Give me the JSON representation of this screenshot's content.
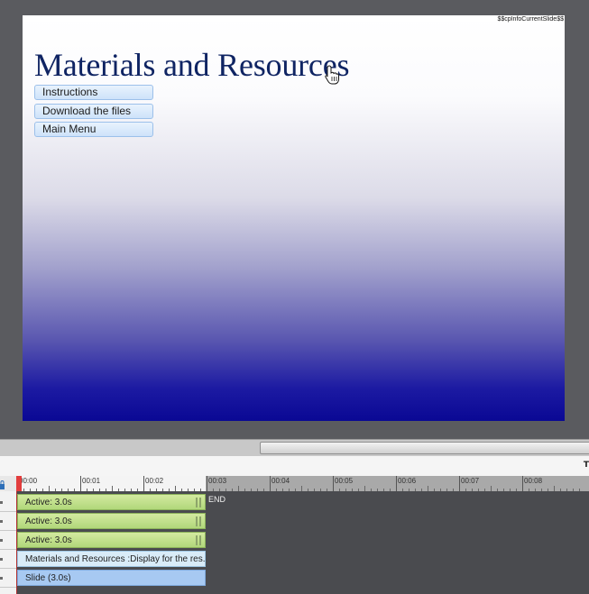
{
  "slide": {
    "info_text": "$$cpInfoCurrentSlide$$",
    "title": "Materials and Resources",
    "buttons": [
      "Instructions",
      "Download the files",
      "Main Menu"
    ],
    "background_colors": [
      "#ffffff",
      "#0a0894"
    ]
  },
  "timeline": {
    "header_text": "T",
    "ruler_labels": [
      "00:00",
      "00:01",
      "00:02",
      "00:03",
      "00:04",
      "00:05",
      "00:06",
      "00:07",
      "00:08"
    ],
    "end_label": "END",
    "tracks": [
      {
        "label": "Active: 3.0s",
        "kind": "green"
      },
      {
        "label": "Active: 3.0s",
        "kind": "green"
      },
      {
        "label": "Active: 3.0s",
        "kind": "green"
      },
      {
        "label": "Materials and Resources :Display for the res...",
        "kind": "cyan"
      },
      {
        "label": "Slide (3.0s)",
        "kind": "blue"
      }
    ]
  },
  "colors": {
    "green_bar": "#b1d77a",
    "caption_bar": "#d9ecf8",
    "slide_bar": "#a7c9f2",
    "playhead": "#e23d3d"
  }
}
